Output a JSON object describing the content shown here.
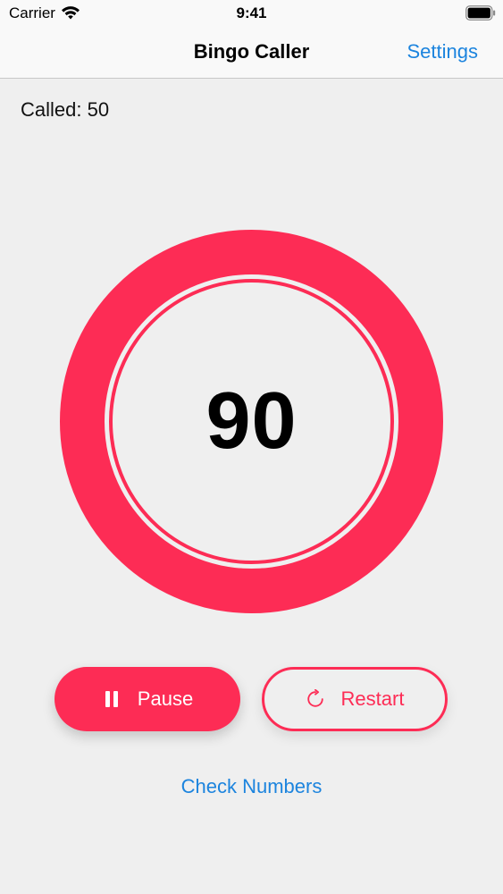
{
  "status_bar": {
    "carrier": "Carrier",
    "time": "9:41"
  },
  "nav": {
    "title": "Bingo Caller",
    "settings_label": "Settings"
  },
  "called": {
    "label": "Called:",
    "count": "50"
  },
  "current_number": "90",
  "controls": {
    "pause_label": "Pause",
    "restart_label": "Restart"
  },
  "check_numbers_label": "Check Numbers",
  "colors": {
    "accent": "#fd2c55",
    "link": "#1c84de",
    "background": "#efefef"
  },
  "icons": {
    "wifi": "wifi-icon",
    "battery": "battery-icon",
    "pause": "pause-icon",
    "restart": "restart-icon"
  }
}
